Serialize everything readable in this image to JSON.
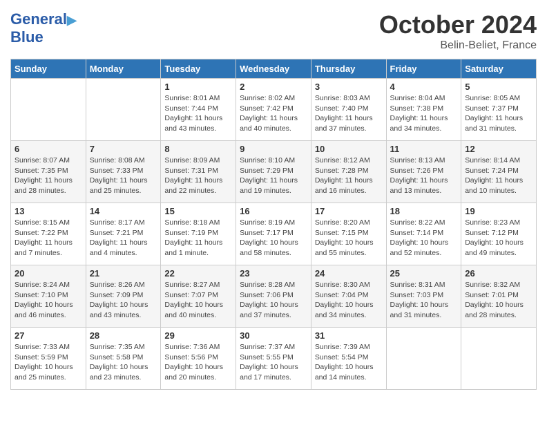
{
  "header": {
    "logo_line1": "General",
    "logo_line2": "Blue",
    "month": "October 2024",
    "location": "Belin-Beliet, France"
  },
  "weekdays": [
    "Sunday",
    "Monday",
    "Tuesday",
    "Wednesday",
    "Thursday",
    "Friday",
    "Saturday"
  ],
  "weeks": [
    [
      {
        "day": "",
        "info": ""
      },
      {
        "day": "",
        "info": ""
      },
      {
        "day": "1",
        "info": "Sunrise: 8:01 AM\nSunset: 7:44 PM\nDaylight: 11 hours and 43 minutes."
      },
      {
        "day": "2",
        "info": "Sunrise: 8:02 AM\nSunset: 7:42 PM\nDaylight: 11 hours and 40 minutes."
      },
      {
        "day": "3",
        "info": "Sunrise: 8:03 AM\nSunset: 7:40 PM\nDaylight: 11 hours and 37 minutes."
      },
      {
        "day": "4",
        "info": "Sunrise: 8:04 AM\nSunset: 7:38 PM\nDaylight: 11 hours and 34 minutes."
      },
      {
        "day": "5",
        "info": "Sunrise: 8:05 AM\nSunset: 7:37 PM\nDaylight: 11 hours and 31 minutes."
      }
    ],
    [
      {
        "day": "6",
        "info": "Sunrise: 8:07 AM\nSunset: 7:35 PM\nDaylight: 11 hours and 28 minutes."
      },
      {
        "day": "7",
        "info": "Sunrise: 8:08 AM\nSunset: 7:33 PM\nDaylight: 11 hours and 25 minutes."
      },
      {
        "day": "8",
        "info": "Sunrise: 8:09 AM\nSunset: 7:31 PM\nDaylight: 11 hours and 22 minutes."
      },
      {
        "day": "9",
        "info": "Sunrise: 8:10 AM\nSunset: 7:29 PM\nDaylight: 11 hours and 19 minutes."
      },
      {
        "day": "10",
        "info": "Sunrise: 8:12 AM\nSunset: 7:28 PM\nDaylight: 11 hours and 16 minutes."
      },
      {
        "day": "11",
        "info": "Sunrise: 8:13 AM\nSunset: 7:26 PM\nDaylight: 11 hours and 13 minutes."
      },
      {
        "day": "12",
        "info": "Sunrise: 8:14 AM\nSunset: 7:24 PM\nDaylight: 11 hours and 10 minutes."
      }
    ],
    [
      {
        "day": "13",
        "info": "Sunrise: 8:15 AM\nSunset: 7:22 PM\nDaylight: 11 hours and 7 minutes."
      },
      {
        "day": "14",
        "info": "Sunrise: 8:17 AM\nSunset: 7:21 PM\nDaylight: 11 hours and 4 minutes."
      },
      {
        "day": "15",
        "info": "Sunrise: 8:18 AM\nSunset: 7:19 PM\nDaylight: 11 hours and 1 minute."
      },
      {
        "day": "16",
        "info": "Sunrise: 8:19 AM\nSunset: 7:17 PM\nDaylight: 10 hours and 58 minutes."
      },
      {
        "day": "17",
        "info": "Sunrise: 8:20 AM\nSunset: 7:15 PM\nDaylight: 10 hours and 55 minutes."
      },
      {
        "day": "18",
        "info": "Sunrise: 8:22 AM\nSunset: 7:14 PM\nDaylight: 10 hours and 52 minutes."
      },
      {
        "day": "19",
        "info": "Sunrise: 8:23 AM\nSunset: 7:12 PM\nDaylight: 10 hours and 49 minutes."
      }
    ],
    [
      {
        "day": "20",
        "info": "Sunrise: 8:24 AM\nSunset: 7:10 PM\nDaylight: 10 hours and 46 minutes."
      },
      {
        "day": "21",
        "info": "Sunrise: 8:26 AM\nSunset: 7:09 PM\nDaylight: 10 hours and 43 minutes."
      },
      {
        "day": "22",
        "info": "Sunrise: 8:27 AM\nSunset: 7:07 PM\nDaylight: 10 hours and 40 minutes."
      },
      {
        "day": "23",
        "info": "Sunrise: 8:28 AM\nSunset: 7:06 PM\nDaylight: 10 hours and 37 minutes."
      },
      {
        "day": "24",
        "info": "Sunrise: 8:30 AM\nSunset: 7:04 PM\nDaylight: 10 hours and 34 minutes."
      },
      {
        "day": "25",
        "info": "Sunrise: 8:31 AM\nSunset: 7:03 PM\nDaylight: 10 hours and 31 minutes."
      },
      {
        "day": "26",
        "info": "Sunrise: 8:32 AM\nSunset: 7:01 PM\nDaylight: 10 hours and 28 minutes."
      }
    ],
    [
      {
        "day": "27",
        "info": "Sunrise: 7:33 AM\nSunset: 5:59 PM\nDaylight: 10 hours and 25 minutes."
      },
      {
        "day": "28",
        "info": "Sunrise: 7:35 AM\nSunset: 5:58 PM\nDaylight: 10 hours and 23 minutes."
      },
      {
        "day": "29",
        "info": "Sunrise: 7:36 AM\nSunset: 5:56 PM\nDaylight: 10 hours and 20 minutes."
      },
      {
        "day": "30",
        "info": "Sunrise: 7:37 AM\nSunset: 5:55 PM\nDaylight: 10 hours and 17 minutes."
      },
      {
        "day": "31",
        "info": "Sunrise: 7:39 AM\nSunset: 5:54 PM\nDaylight: 10 hours and 14 minutes."
      },
      {
        "day": "",
        "info": ""
      },
      {
        "day": "",
        "info": ""
      }
    ]
  ]
}
